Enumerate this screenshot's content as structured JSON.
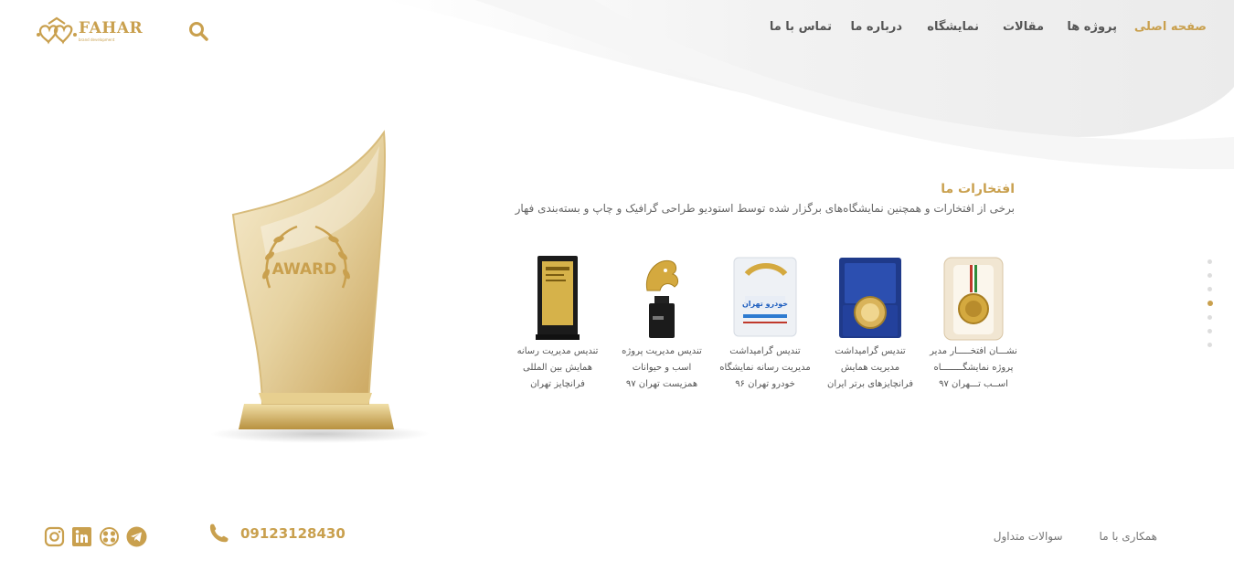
{
  "brand": {
    "name": "FAHAR",
    "tagline": "brand development"
  },
  "nav": {
    "items": [
      {
        "label": "صفحه اصلی",
        "active": true
      },
      {
        "label": "پروژه ها"
      },
      {
        "label": "مقالات"
      },
      {
        "label": "نمایشگاه"
      },
      {
        "label": "درباره ما"
      },
      {
        "label": "تماس با ما"
      }
    ]
  },
  "hero": {
    "award_text": "AWARD"
  },
  "section": {
    "title": "افتخارات ما",
    "subtitle": "برخی از افتخارات و همچنین نمایشگاه‌های برگزار شده توسط استودیو طراحی گرافیک و چاپ و بسته‌بندی فهار"
  },
  "awards": [
    {
      "caption": "نشـــان افتخـــــار مدیر\nپروژه نمایشگــــــــاه\nاســب تـــهران ۹۷",
      "icon": "medal-icon"
    },
    {
      "caption": "تندیس گرامیداشت\nمدیریت همایش\nفرانچایزهای برتر ایران",
      "icon": "plaque-box-icon"
    },
    {
      "caption": "تندیس گرامیداشت\nمدیریت رسانه نمایشگاه\nخودرو تهران ۹۶",
      "icon": "crystal-plaque-icon",
      "plaque_text": "خودرو تهران"
    },
    {
      "caption": "تندیس مدیریت پروژه\nاسب و حیوانات\nهمزیست تهران ۹۷",
      "icon": "horse-trophy-icon"
    },
    {
      "caption": "تندیس مدیریت رسانه\nهمایش بین المللی\nفرانچایز تهران",
      "icon": "gold-plaque-icon"
    }
  ],
  "pager": {
    "count": 7,
    "active_index": 3
  },
  "footer": {
    "phone": "09123128430",
    "links": [
      {
        "label": "همکاری با ما"
      },
      {
        "label": "سوالات متداول"
      }
    ],
    "social": [
      "instagram-icon",
      "linkedin-icon",
      "aparat-icon",
      "telegram-icon"
    ]
  },
  "colors": {
    "accent": "#c9a04e",
    "text": "#555555",
    "muted": "#777777"
  }
}
